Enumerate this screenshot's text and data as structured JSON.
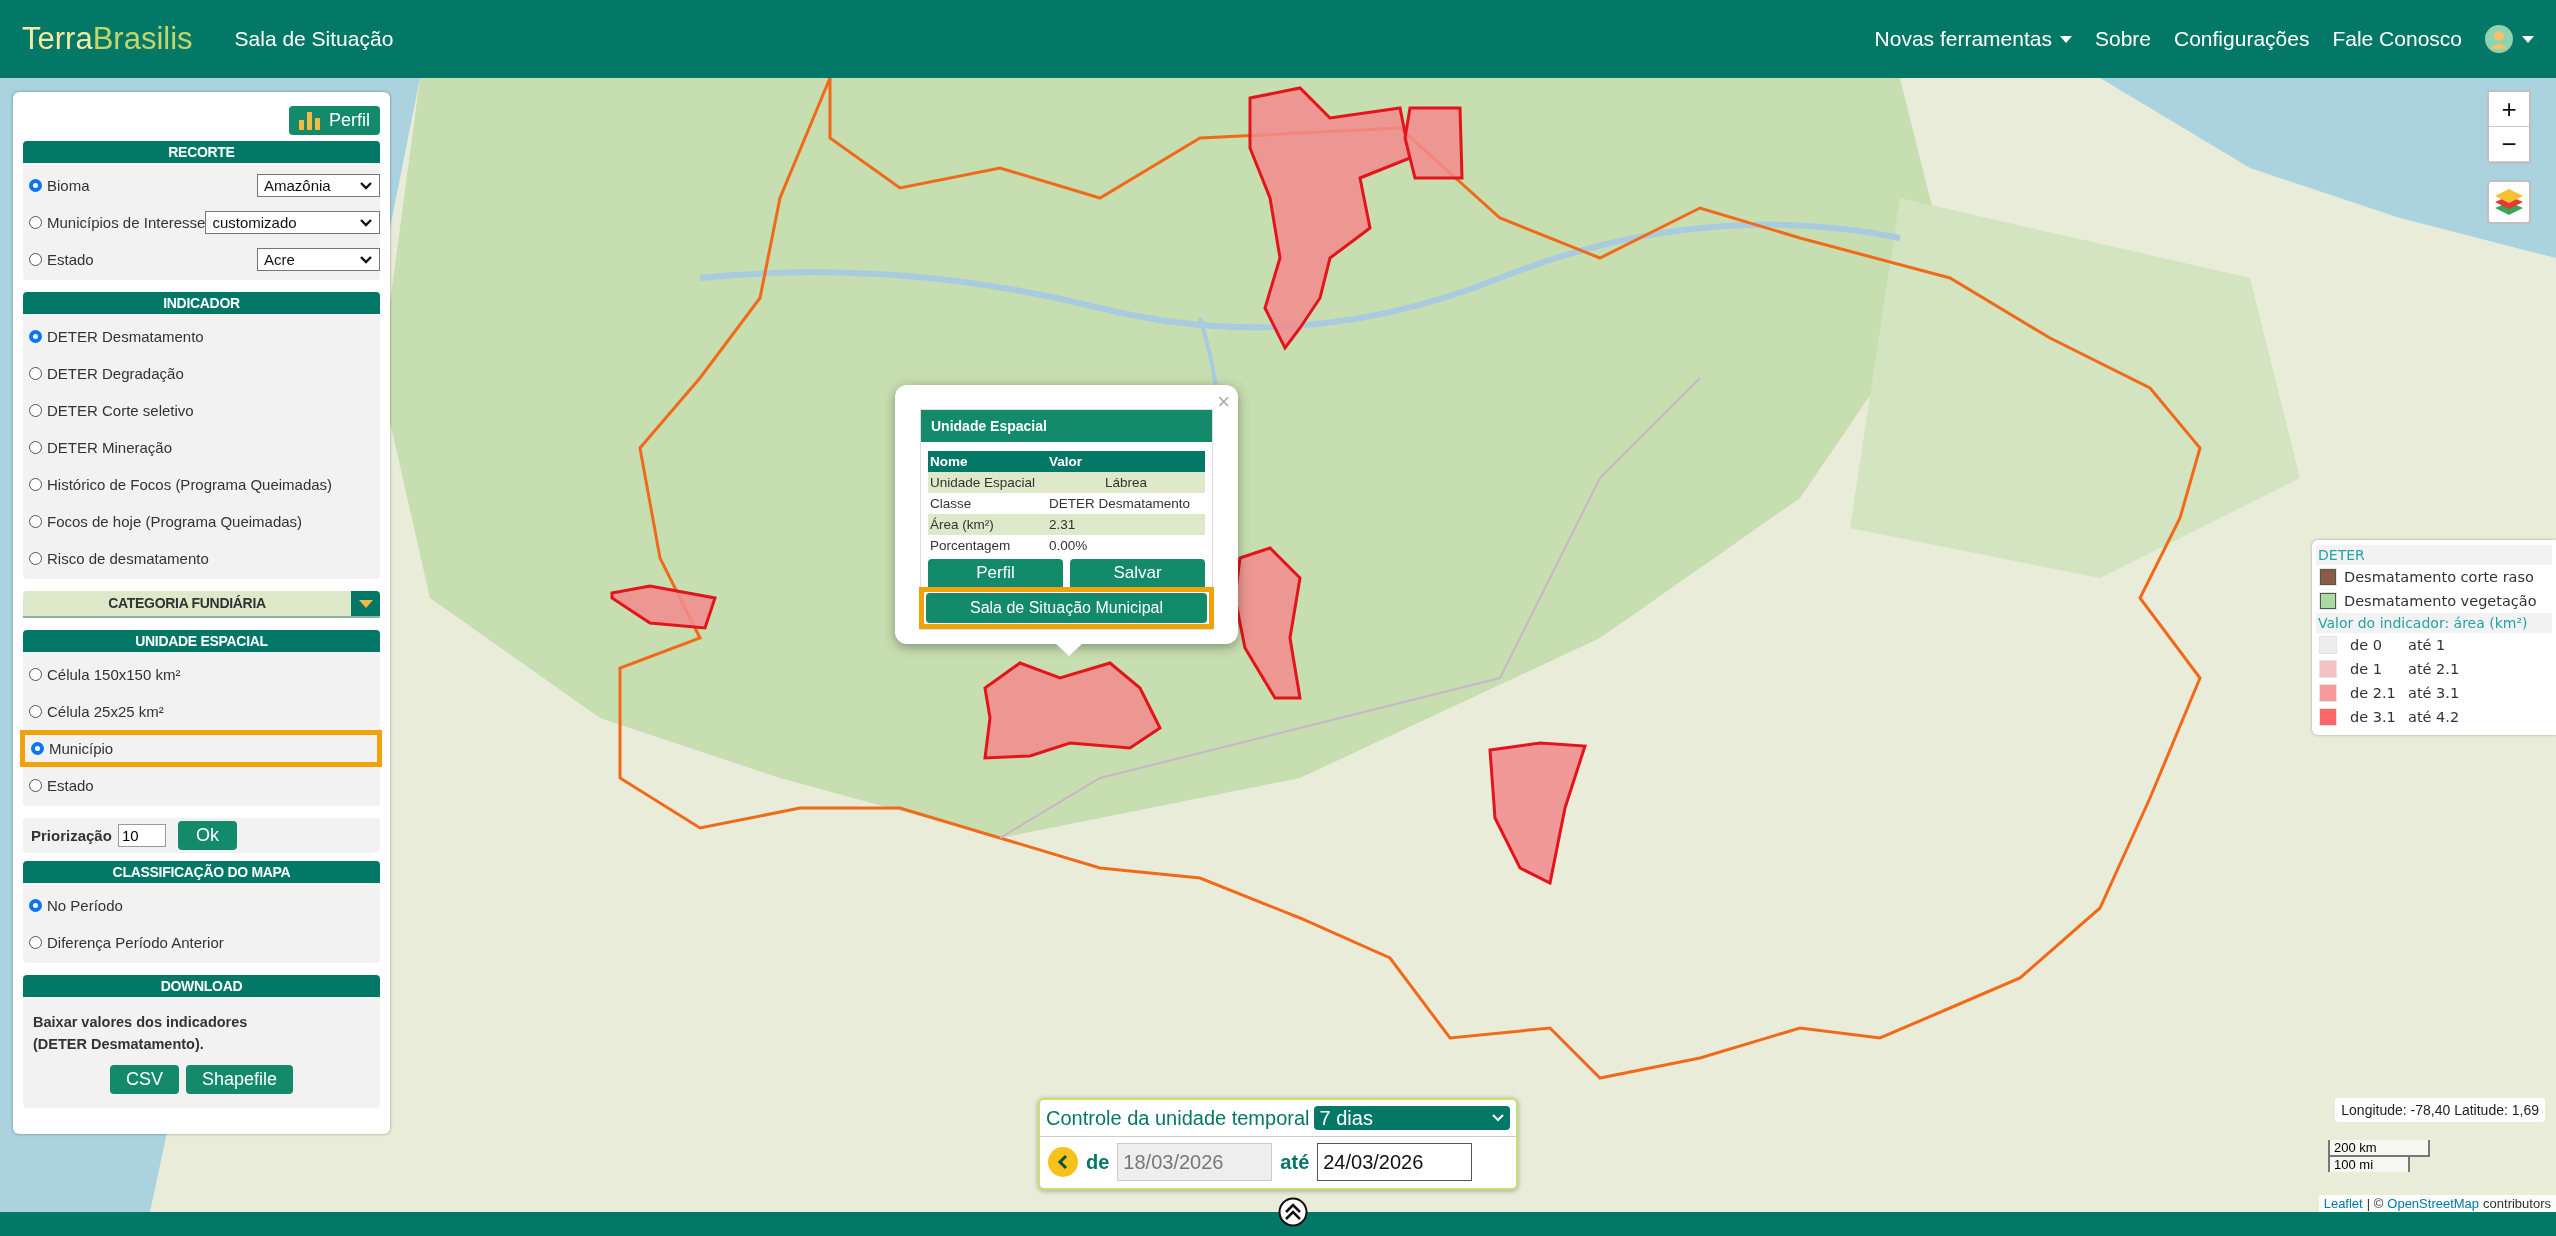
{
  "header": {
    "brand": [
      "Terra",
      "Brasilis"
    ],
    "title": "Sala de Situação",
    "nav": [
      {
        "label": "Novas ferramentas",
        "dropdown": true
      },
      {
        "label": "Sobre",
        "dropdown": false
      },
      {
        "label": "Configurações",
        "dropdown": false
      },
      {
        "label": "Fale Conosco",
        "dropdown": false
      }
    ]
  },
  "panel": {
    "perfil_button": "Perfil",
    "recorte": {
      "title": "RECORTE",
      "options": [
        {
          "label": "Bioma",
          "selected": true,
          "value": "Amazônia"
        },
        {
          "label": "Municípios de Interesse",
          "selected": false,
          "value": "customizado"
        },
        {
          "label": "Estado",
          "selected": false,
          "value": "Acre"
        }
      ]
    },
    "indicador": {
      "title": "INDICADOR",
      "options": [
        {
          "label": "DETER Desmatamento",
          "selected": true
        },
        {
          "label": "DETER Degradação",
          "selected": false
        },
        {
          "label": "DETER Corte seletivo",
          "selected": false
        },
        {
          "label": "DETER Mineração",
          "selected": false
        },
        {
          "label": "Histórico de Focos (Programa Queimadas)",
          "selected": false
        },
        {
          "label": "Focos de hoje (Programa Queimadas)",
          "selected": false
        },
        {
          "label": "Risco de desmatamento",
          "selected": false
        }
      ]
    },
    "categoria": {
      "title": "CATEGORIA FUNDIÁRIA"
    },
    "unidade": {
      "title": "UNIDADE ESPACIAL",
      "options": [
        {
          "label": "Célula 150x150 km²",
          "selected": false,
          "highlighted": false
        },
        {
          "label": "Célula 25x25 km²",
          "selected": false,
          "highlighted": false
        },
        {
          "label": "Município",
          "selected": true,
          "highlighted": true
        },
        {
          "label": "Estado",
          "selected": false,
          "highlighted": false
        }
      ]
    },
    "priorizacao": {
      "label": "Priorização",
      "value": "10",
      "button": "Ok"
    },
    "classificacao": {
      "title": "CLASSIFICAÇÃO DO MAPA",
      "options": [
        {
          "label": "No Período",
          "selected": true
        },
        {
          "label": "Diferença Período Anterior",
          "selected": false
        }
      ]
    },
    "download": {
      "title": "DOWNLOAD",
      "text": [
        "Baixar valores dos indicadores",
        "(DETER Desmatamento)."
      ],
      "buttons": [
        "CSV",
        "Shapefile"
      ]
    }
  },
  "popup": {
    "title": "Unidade Espacial",
    "columns": [
      "Nome",
      "Valor"
    ],
    "rows": [
      [
        "Unidade Espacial",
        "Lábrea"
      ],
      [
        "Classe",
        "DETER Desmatamento"
      ],
      [
        "Área (km²)",
        "2.31"
      ],
      [
        "Porcentagem",
        "0.00%"
      ]
    ],
    "buttons": [
      "Perfil",
      "Salvar"
    ],
    "main_button": {
      "label": "Sala de Situação Municipal",
      "highlighted": true
    },
    "close": "×"
  },
  "map_controls": {
    "zoom_in": "+",
    "zoom_out": "−"
  },
  "legend": {
    "title": "DETER",
    "classes": [
      {
        "label": "Desmatamento corte raso",
        "color": "#8b5a44"
      },
      {
        "label": "Desmatamento vegetação",
        "color": "#a8dca0"
      }
    ],
    "subtitle": "Valor do indicador: área (km²)",
    "ranges": [
      {
        "from": "de 0",
        "to": "até 1",
        "color": "#ededed"
      },
      {
        "from": "de 1",
        "to": "até 2.1",
        "color": "#f4c2c4"
      },
      {
        "from": "de 2.1",
        "to": "até 3.1",
        "color": "#f79a9b"
      },
      {
        "from": "de 3.1",
        "to": "até 4.2",
        "color": "#fb6768"
      }
    ]
  },
  "time_control": {
    "title": "Controle da unidade temporal",
    "period": "7 dias",
    "from_label": "de",
    "from": "18/03/2026",
    "to_label": "até",
    "to": "24/03/2026"
  },
  "coordinates": "Longitude: -78,40 Latitude: 1,69",
  "scale": [
    "200 km",
    "100 mi"
  ],
  "attribution": {
    "links": [
      "Leaflet",
      "OpenStreetMap"
    ],
    "separator": "| ©",
    "suffix": "contributors"
  }
}
